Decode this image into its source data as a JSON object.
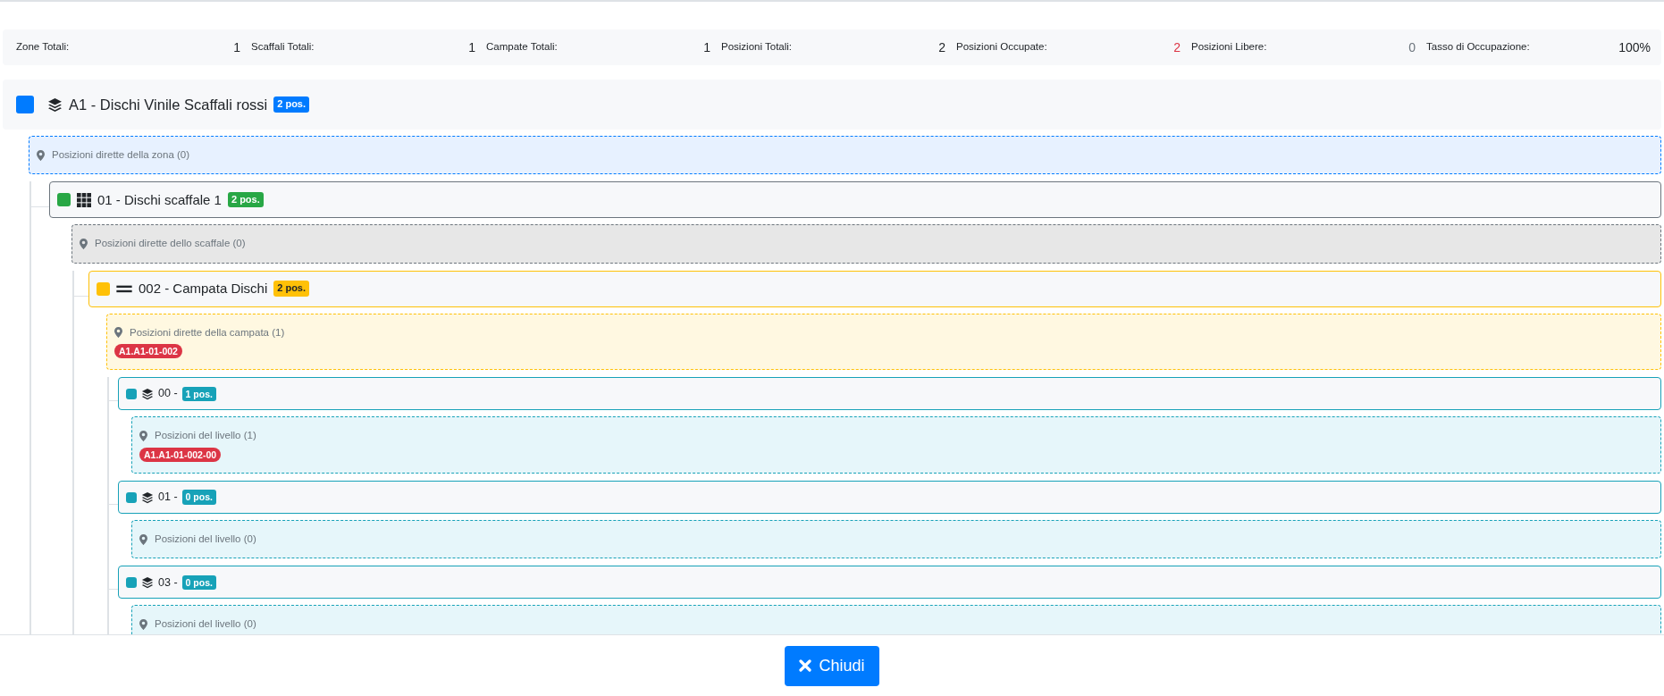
{
  "stats": [
    {
      "label": "Zone Totali:",
      "value": "1",
      "color": "#212529"
    },
    {
      "label": "Scaffali Totali:",
      "value": "1",
      "color": "#212529"
    },
    {
      "label": "Campate Totali:",
      "value": "1",
      "color": "#212529"
    },
    {
      "label": "Posizioni Totali:",
      "value": "2",
      "color": "#212529"
    },
    {
      "label": "Posizioni Occupate:",
      "value": "2",
      "color": "#dc3545"
    },
    {
      "label": "Posizioni Libere:",
      "value": "0",
      "color": "#6c757d"
    },
    {
      "label": "Tasso di Occupazione:",
      "value": "100%",
      "color": "#212529"
    }
  ],
  "zones": [
    {
      "kind": "zone",
      "color": "#007bff",
      "title": "A1 - Dischi Vinile Scaffali rossi",
      "badge": "2 pos.",
      "direct": {
        "label": "Posizioni dirette della zona (0)"
      },
      "children": [
        {
          "kind": "shelf",
          "color": "#28a745",
          "title": "01 - Dischi scaffale 1",
          "badge": "2 pos.",
          "direct": {
            "label": "Posizioni dirette dello scaffale (0)"
          },
          "children": [
            {
              "kind": "bay",
              "color": "#ffc107",
              "title": "002 - Campata Dischi",
              "badge": "2 pos.",
              "direct": {
                "label": "Posizioni dirette della campata (1)",
                "positions": [
                  "A1.A1-01-002"
                ]
              },
              "children": [
                {
                  "kind": "level",
                  "color": "#17a2b8",
                  "title": "00 -",
                  "badge": "1 pos.",
                  "direct": {
                    "label": "Posizioni del livello (1)",
                    "positions": [
                      "A1.A1-01-002-00"
                    ]
                  }
                },
                {
                  "kind": "level",
                  "color": "#17a2b8",
                  "title": "01 -",
                  "badge": "0 pos.",
                  "direct": {
                    "label": "Posizioni del livello (0)"
                  }
                },
                {
                  "kind": "level",
                  "color": "#17a2b8",
                  "title": "03 -",
                  "badge": "0 pos.",
                  "direct": {
                    "label": "Posizioni del livello (0)"
                  }
                }
              ]
            }
          ]
        }
      ]
    }
  ],
  "close_button": "Chiudi"
}
